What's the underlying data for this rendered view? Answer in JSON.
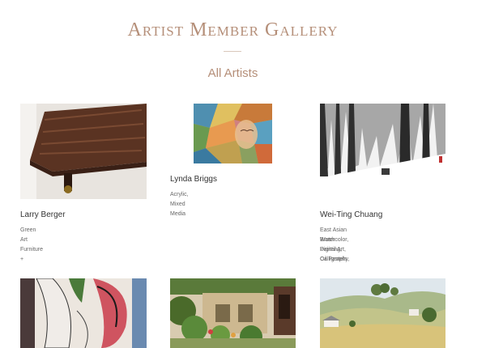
{
  "page": {
    "title": "Artist Member Gallery",
    "subtitle": "All Artists"
  },
  "artists": [
    {
      "name": "Larry Berger",
      "media": "Green Art Furniture +",
      "image": "wood-table-slab"
    },
    {
      "name": "Lynda Briggs",
      "media": "Acrylic, Mixed Media",
      "image": "stained-glass-face-painting"
    },
    {
      "name": "Wei-Ting Chuang",
      "media_line1": "East Asian Brush Painting, Calligraphy,",
      "media_line2": "Watercolor, Digital Art, Oil Pastels",
      "image": "misty-forest-ink-painting"
    },
    {
      "image": "abstract-heart-painting"
    },
    {
      "image": "garden-courtyard-painting"
    },
    {
      "image": "rolling-hills-landscape"
    }
  ]
}
